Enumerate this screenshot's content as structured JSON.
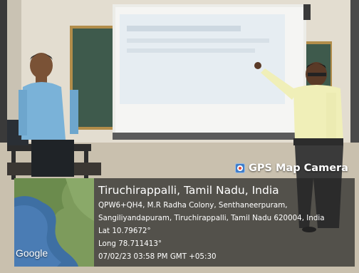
{
  "overlay": {
    "app_badge": "GPS Map Camera",
    "location_title": "Tiruchirappalli, Tamil Nadu, India",
    "address_line1": "QPW6+QH4, M.R Radha Colony, Senthaneerpuram,",
    "address_line2": "Sangiliyandapuram, Tiruchirappalli, Tamil Nadu 620004, India",
    "latitude": "Lat 10.79672°",
    "longitude": "Long 78.711413°",
    "timestamp": "07/02/23 03:58 PM GMT +05:30",
    "map_logo": "Google",
    "badge_icon": "map-camera-icon"
  }
}
